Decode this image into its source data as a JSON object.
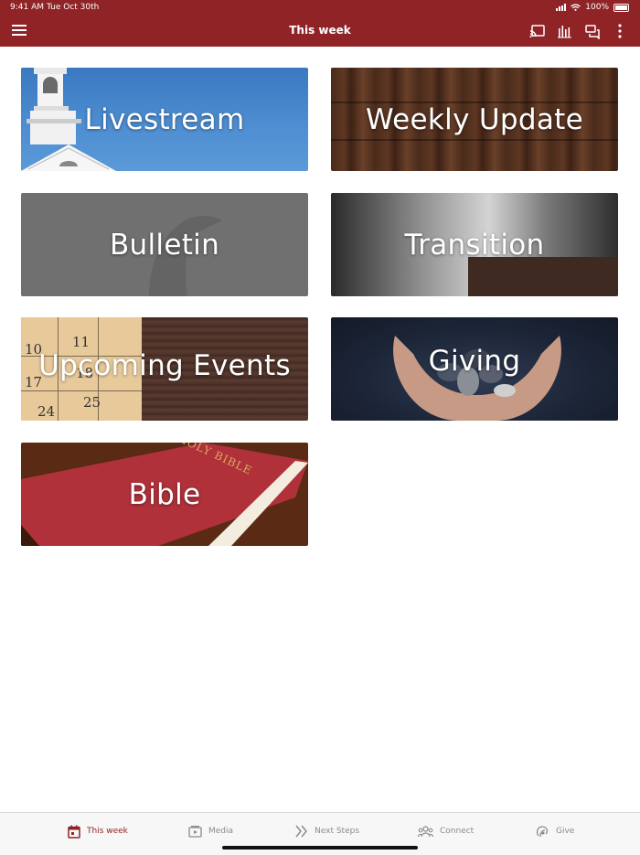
{
  "status_bar": {
    "time": "9:41 AM",
    "date": "Tue Oct 30th",
    "battery": "100%"
  },
  "header": {
    "title": "This week",
    "icons": [
      "menu-icon",
      "cast-icon",
      "audio-bars-icon",
      "chat-icon",
      "more-vertical-icon"
    ]
  },
  "tiles": [
    {
      "label": "Livestream"
    },
    {
      "label": "Weekly Update"
    },
    {
      "label": "Bulletin"
    },
    {
      "label": "Transition"
    },
    {
      "label": "Upcoming Events"
    },
    {
      "label": "Giving"
    },
    {
      "label": "Bible"
    }
  ],
  "calendar_numbers": [
    "10",
    "11",
    "17",
    "18",
    "24",
    "25"
  ],
  "bible_cover_text": "HOLY BIBLE",
  "tabs": [
    {
      "label": "This week",
      "icon": "calendar-icon",
      "active": true
    },
    {
      "label": "Media",
      "icon": "media-icon",
      "active": false
    },
    {
      "label": "Next Steps",
      "icon": "double-chevron-icon",
      "active": false
    },
    {
      "label": "Connect",
      "icon": "people-icon",
      "active": false
    },
    {
      "label": "Give",
      "icon": "give-icon",
      "active": false
    }
  ],
  "colors": {
    "brand": "#8f2326",
    "tab_inactive": "#8a8a8a",
    "background": "#ffffff"
  }
}
